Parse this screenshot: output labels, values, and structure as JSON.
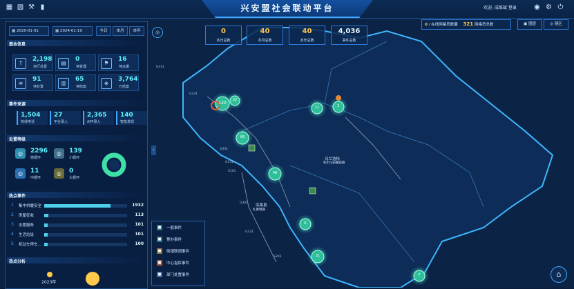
{
  "header": {
    "title": "兴安盟社会联动平台",
    "user_text": "欢迎: 成维斌 登录"
  },
  "filters": {
    "start_date": "2020-01-01",
    "end_date": "2024-01-19",
    "periods": [
      "今日",
      "本月",
      "本年"
    ]
  },
  "basic": {
    "title": "基本信息",
    "cards": [
      {
        "num": "2,198",
        "label": "自行处置",
        "icon": "↑"
      },
      {
        "num": "0",
        "label": "待受理",
        "icon": "▤"
      },
      {
        "num": "16",
        "label": "待派遣",
        "icon": "⚑"
      },
      {
        "num": "91",
        "label": "待处置",
        "icon": "≡"
      },
      {
        "num": "65",
        "label": "待结案",
        "icon": "▥"
      },
      {
        "num": "3,764",
        "label": "已结案",
        "icon": "◈"
      }
    ]
  },
  "source": {
    "title": "事件来源",
    "items": [
      {
        "num": "1,504",
        "label": "热线电话"
      },
      {
        "num": "27",
        "label": "平台录入"
      },
      {
        "num": "2,365",
        "label": "APP录入"
      },
      {
        "num": "140",
        "label": "智能发现"
      }
    ]
  },
  "disposal": {
    "title": "处置等级",
    "items": [
      {
        "num": "2296",
        "label": "微循环",
        "color": "#2f8fb0",
        "icon": "◎"
      },
      {
        "num": "139",
        "label": "小循环",
        "color": "#3f6f8a",
        "icon": "◎"
      },
      {
        "num": "11",
        "label": "中循环",
        "color": "#2b6fb0",
        "icon": "◎"
      },
      {
        "num": "0",
        "label": "大循环",
        "color": "#6a6a3a",
        "icon": "◎"
      }
    ],
    "donut_color": "#3ee0a8"
  },
  "hot": {
    "title": "热点事件",
    "items": [
      {
        "idx": "1",
        "label": "集中供暖安全",
        "value": "1932",
        "frac": 0.8
      },
      {
        "idx": "2",
        "label": "房屋征收",
        "value": "113",
        "frac": 0.05
      },
      {
        "idx": "3",
        "label": "志愿服务",
        "value": "101",
        "frac": 0.045
      },
      {
        "idx": "4",
        "label": "生活垃圾",
        "value": "101",
        "frac": 0.045
      },
      {
        "idx": "5",
        "label": "机动车停车...",
        "value": "100",
        "frac": 0.044
      }
    ]
  },
  "hot_analysis": {
    "title": "热点分析",
    "year": "2023年"
  },
  "stats": [
    {
      "num": "0",
      "label": "本日总数"
    },
    {
      "num": "40",
      "label": "本月总数"
    },
    {
      "num": "40",
      "label": "本年总数"
    },
    {
      "num": "4,036",
      "label": "事件总数"
    }
  ],
  "online": {
    "count": "0",
    "label1": "在线网格员数量",
    "total": "321",
    "label2": "网格员总数"
  },
  "map_buttons": [
    "图层",
    "辖区"
  ],
  "legend": [
    {
      "label": "一般事件",
      "color": "#2e7a8a"
    },
    {
      "label": "警办事件",
      "color": "#2e7a8a"
    },
    {
      "label": "街镇联调事件",
      "color": "#8a7a3a"
    },
    {
      "label": "中心指挥事件",
      "color": "#b05a3a"
    },
    {
      "label": "部门处置事件",
      "color": "#3a6ab0"
    }
  ],
  "map_labels": {
    "roads": [
      "G331",
      "G331",
      "G331",
      "G331",
      "G302",
      "S101",
      "G331",
      "S203"
    ],
    "towns": [
      "乌兰浩特",
      "科尔沁右翼前旗",
      "突泉县",
      "扎赉特旗"
    ],
    "clusters": [
      "120",
      "32",
      "11",
      "2",
      "66",
      "48",
      "6",
      "21",
      "7"
    ]
  }
}
